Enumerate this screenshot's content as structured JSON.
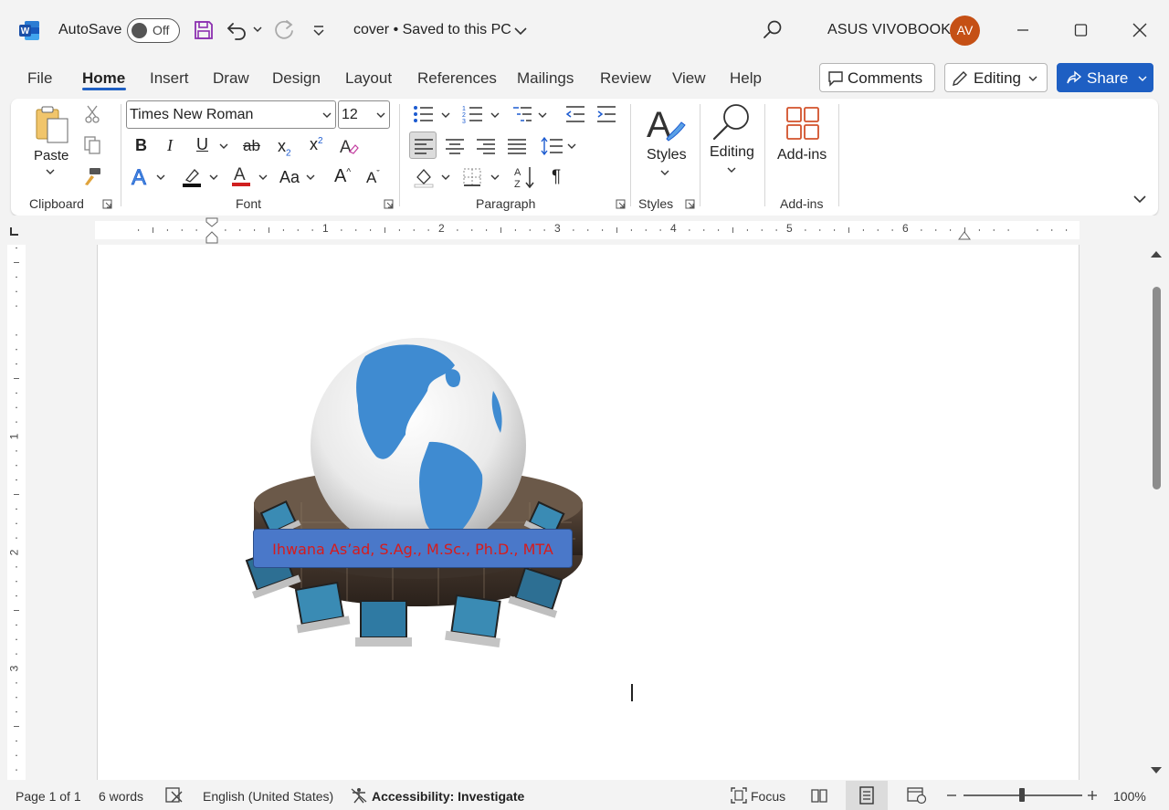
{
  "titlebar": {
    "autosave_label": "AutoSave",
    "autosave_state": "Off",
    "doc_title": "cover • Saved to this PC",
    "user_name": "ASUS VIVOBOOK",
    "avatar_initials": "AV"
  },
  "tabs": [
    {
      "label": "File"
    },
    {
      "label": "Home"
    },
    {
      "label": "Insert"
    },
    {
      "label": "Draw"
    },
    {
      "label": "Design"
    },
    {
      "label": "Layout"
    },
    {
      "label": "References"
    },
    {
      "label": "Mailings"
    },
    {
      "label": "Review"
    },
    {
      "label": "View"
    },
    {
      "label": "Help"
    }
  ],
  "header_buttons": {
    "comments": "Comments",
    "editing": "Editing",
    "share": "Share"
  },
  "ribbon": {
    "clipboard": {
      "paste": "Paste",
      "label": "Clipboard"
    },
    "font": {
      "font_name": "Times New Roman",
      "font_size": "12",
      "label": "Font",
      "bold": "B",
      "italic": "I",
      "underline": "U",
      "strike": "ab",
      "sub": "x",
      "sup": "x",
      "change_case": "Aa",
      "grow": "A",
      "shrink": "A"
    },
    "paragraph": {
      "label": "Paragraph",
      "marks": "¶"
    },
    "styles": {
      "button": "Styles",
      "label": "Styles"
    },
    "editing": {
      "button": "Editing"
    },
    "addins": {
      "button": "Add-ins",
      "label": "Add-ins"
    }
  },
  "ruler": {
    "h_numbers": [
      "1",
      "2",
      "3",
      "4",
      "5",
      "6"
    ],
    "v_numbers": [
      "1",
      "2",
      "3"
    ]
  },
  "document": {
    "name_text": "Ihwana As’ad, S.Ag., M.Sc., Ph.D., MTA"
  },
  "statusbar": {
    "page": "Page 1 of 1",
    "words": "6 words",
    "language": "English (United States)",
    "accessibility": "Accessibility: Investigate",
    "focus": "Focus",
    "zoom": "100%"
  },
  "colors": {
    "accent": "#1e5fc3",
    "avatar": "#c55015",
    "name_box": "#4a78c9",
    "name_text": "#d81b1b",
    "word_blue": "#1c5bd0"
  }
}
